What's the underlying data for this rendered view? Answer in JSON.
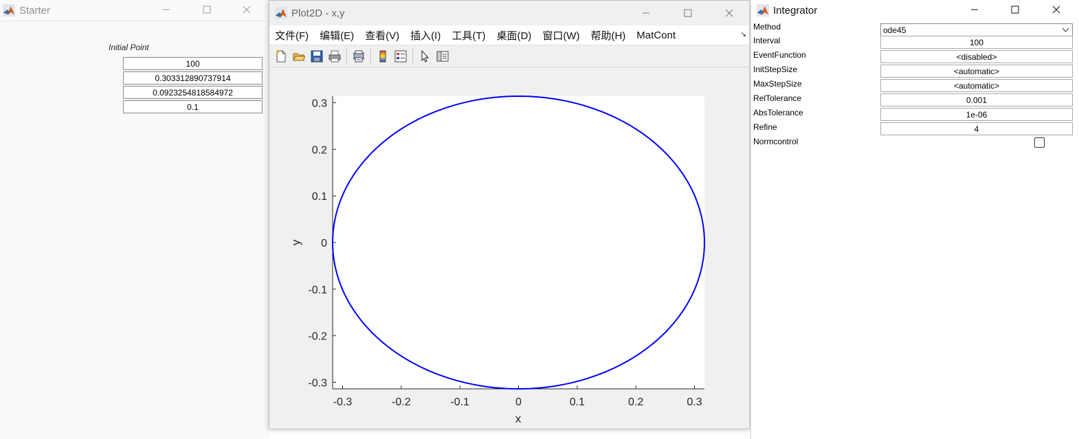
{
  "starter": {
    "title": "Starter",
    "initial_point_label": "Initial Point",
    "values": [
      "100",
      "0.303312890737914",
      "0.0923254818584972",
      "0.1"
    ]
  },
  "plot_window": {
    "title": "Plot2D - x,y",
    "menu": [
      "文件(F)",
      "编辑(E)",
      "查看(V)",
      "插入(I)",
      "工具(T)",
      "桌面(D)",
      "窗口(W)",
      "帮助(H)",
      "MatCont"
    ],
    "toolbar_icons": [
      "new-figure-icon",
      "open-file-icon",
      "save-icon",
      "print-icon",
      "print-preview-icon",
      "colorbar-icon",
      "legend-icon",
      "pointer-icon",
      "property-editor-icon"
    ]
  },
  "integrator": {
    "title": "Integrator",
    "properties": [
      {
        "label": "Method",
        "value": "ode45"
      },
      {
        "label": "Interval",
        "value": "100"
      },
      {
        "label": "EventFunction",
        "value": "<disabled>"
      },
      {
        "label": "InitStepSize",
        "value": "<automatic>"
      },
      {
        "label": "MaxStepSize",
        "value": "<automatic>"
      },
      {
        "label": "RelTolerance",
        "value": "0.001"
      },
      {
        "label": "AbsTolerance",
        "value": "1e-06"
      },
      {
        "label": "Refine",
        "value": "4"
      }
    ],
    "normcontrol_label": "Normcontrol",
    "normcontrol_checked": false
  },
  "chart_data": {
    "type": "line",
    "title": "",
    "xlabel": "x",
    "ylabel": "y",
    "xlim": [
      -0.317,
      0.317
    ],
    "ylim": [
      -0.314,
      0.314
    ],
    "xticks": [
      "-0.3",
      "-0.2",
      "-0.1",
      "0",
      "0.1",
      "0.2",
      "0.3"
    ],
    "yticks": [
      "0.3",
      "0.2",
      "0.1",
      "0",
      "-0.1",
      "-0.2",
      "-0.3"
    ],
    "series": [
      {
        "shape": "closed orbit (ellipse)",
        "center": [
          0,
          0
        ],
        "x_radius": 0.317,
        "y_radius": 0.314,
        "color": "#0000ff"
      }
    ],
    "grid": false
  }
}
